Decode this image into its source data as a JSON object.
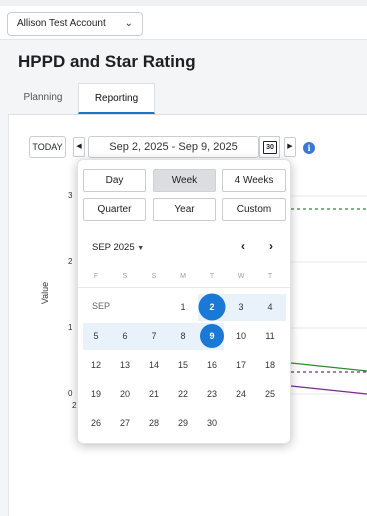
{
  "account": {
    "name": "Allison Test Account"
  },
  "page": {
    "title": "HPPD and Star Rating"
  },
  "tabs": [
    {
      "label": "Planning"
    },
    {
      "label": "Reporting",
      "active": true
    }
  ],
  "toolbar": {
    "today_label": "TODAY",
    "range_label": "Sep 2, 2025 - Sep 9, 2025",
    "calendar_day": "30"
  },
  "chart": {
    "y_axis_label": "Value",
    "y_ticks": [
      "3",
      "2",
      "1",
      "0"
    ],
    "x_tick_partial": "2"
  },
  "picker": {
    "periods": [
      "Day",
      "Week",
      "4 Weeks",
      "Quarter",
      "Year",
      "Custom"
    ],
    "selected_period": "Week",
    "month_label": "SEP 2025",
    "weekdays": [
      "F",
      "S",
      "S",
      "M",
      "T",
      "W",
      "T"
    ],
    "month_abbr": "SEP",
    "weeks": [
      [
        "",
        "",
        "",
        "1",
        "2",
        "3",
        "4"
      ],
      [
        "5",
        "6",
        "7",
        "8",
        "9",
        "10",
        "11"
      ],
      [
        "12",
        "13",
        "14",
        "15",
        "16",
        "17",
        "18"
      ],
      [
        "19",
        "20",
        "21",
        "22",
        "23",
        "24",
        "25"
      ],
      [
        "26",
        "27",
        "28",
        "29",
        "30",
        "",
        ""
      ]
    ],
    "range_start": "2",
    "range_end": "9"
  },
  "colors": {
    "accent": "#1a78d6",
    "green_series": "#2e8b2e",
    "purple_series": "#7a2a8a"
  }
}
